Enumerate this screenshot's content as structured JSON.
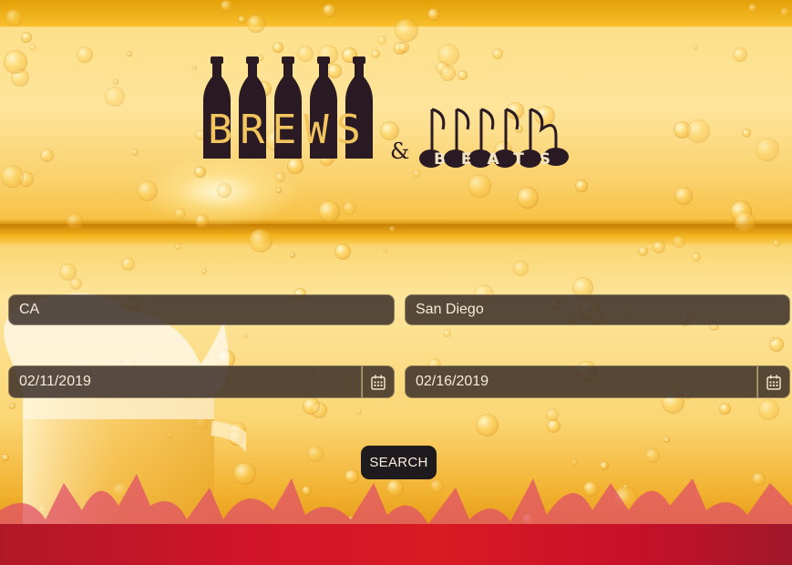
{
  "brand": {
    "word_left": "BREWS",
    "ampersand": "&",
    "word_right": "BEATS"
  },
  "form": {
    "state": {
      "value": "CA"
    },
    "city": {
      "value": "San Diego"
    },
    "start_date": {
      "value": "02/11/2019"
    },
    "end_date": {
      "value": "02/16/2019"
    },
    "search_label": "SEARCH"
  },
  "icons": {
    "calendar": "calendar-icon"
  },
  "colors": {
    "field_bg": "#3a2e28",
    "field_text": "#f6ecd6",
    "button_bg": "#1f1a1e",
    "logo_dark": "#2a1a24",
    "logo_letters": "#f3c55e"
  }
}
